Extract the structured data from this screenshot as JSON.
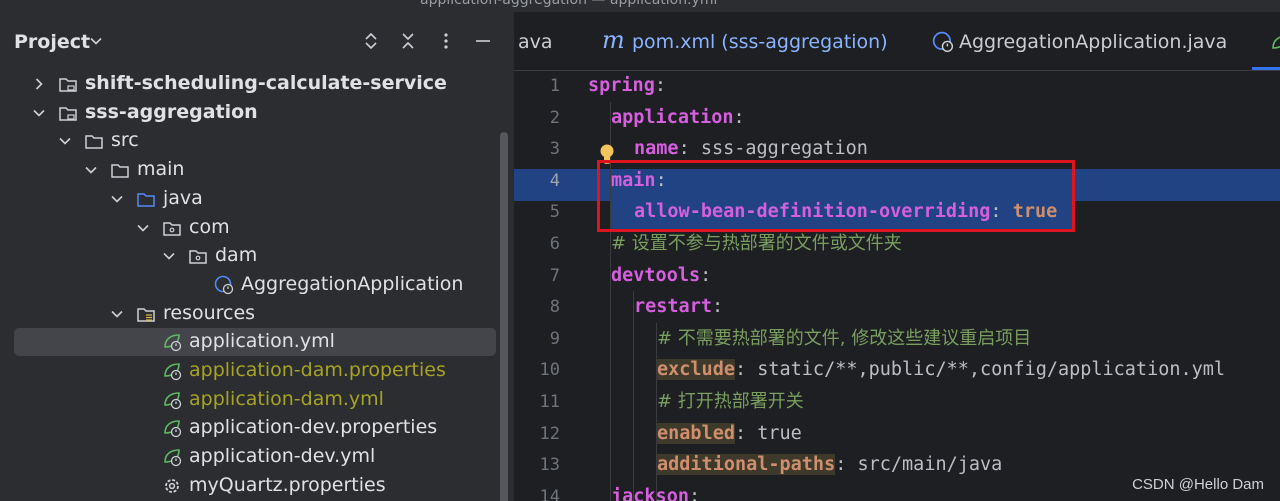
{
  "window": {
    "title_fragment": "application-aggregation — application.yml"
  },
  "project_panel": {
    "title": "Project",
    "tree": [
      {
        "label": "shift-scheduling-calculate-service",
        "type": "module",
        "expanded": false,
        "bold": true
      },
      {
        "label": "sss-aggregation",
        "type": "module",
        "expanded": true,
        "bold": true
      },
      {
        "label": "src",
        "type": "folder",
        "expanded": true
      },
      {
        "label": "main",
        "type": "folder",
        "expanded": true
      },
      {
        "label": "java",
        "type": "source-folder",
        "expanded": true
      },
      {
        "label": "com",
        "type": "package",
        "expanded": true
      },
      {
        "label": "dam",
        "type": "package",
        "expanded": true
      },
      {
        "label": "AggregationApplication",
        "type": "spring-class"
      },
      {
        "label": "resources",
        "type": "resources-folder",
        "expanded": true
      },
      {
        "label": "application.yml",
        "type": "spring-config",
        "selected": true
      },
      {
        "label": "application-dam.properties",
        "type": "spring-config",
        "status": "untracked"
      },
      {
        "label": "application-dam.yml",
        "type": "spring-config",
        "status": "untracked"
      },
      {
        "label": "application-dev.properties",
        "type": "spring-config"
      },
      {
        "label": "application-dev.yml",
        "type": "spring-config"
      },
      {
        "label": "myQuartz.properties",
        "type": "properties"
      }
    ]
  },
  "editor": {
    "tabs": [
      {
        "label": "ava",
        "icon": ""
      },
      {
        "label": "pom.xml (sss-aggregation)",
        "icon": "maven-icon"
      },
      {
        "label": "AggregationApplication.java",
        "icon": "spring-class-icon"
      }
    ],
    "line_numbers": [
      "1",
      "2",
      "3",
      "4",
      "5",
      "6",
      "7",
      "8",
      "9",
      "10",
      "11",
      "12",
      "13",
      "14"
    ],
    "current_line": "4",
    "lines": [
      {
        "key": "spring",
        "punct": ":"
      },
      {
        "key": "application",
        "punct": ":"
      },
      {
        "key": "name",
        "punct": ":",
        "value": " sss-aggregation"
      },
      {
        "key": "main",
        "punct": ":"
      },
      {
        "key": "allow-bean-definition-overriding",
        "punct": ":",
        "value": " true"
      },
      {
        "comment": "# 设置不参与热部署的文件或文件夹"
      },
      {
        "key": "devtools",
        "punct": ":"
      },
      {
        "key": "restart",
        "punct": ":"
      },
      {
        "comment": "# 不需要热部署的文件, 修改这些建议重启项目"
      },
      {
        "key": "exclude",
        "punct": ":",
        "value": " static/**,public/**,config/application.yml"
      },
      {
        "comment": "# 打开热部署开关"
      },
      {
        "key": "enabled",
        "punct": ":",
        "value": " true"
      },
      {
        "key": "additional-paths",
        "punct": ":",
        "value": " src/main/java"
      },
      {
        "key": "jackson",
        "punct": ":"
      }
    ]
  },
  "watermark": "CSDN @Hello Dam"
}
